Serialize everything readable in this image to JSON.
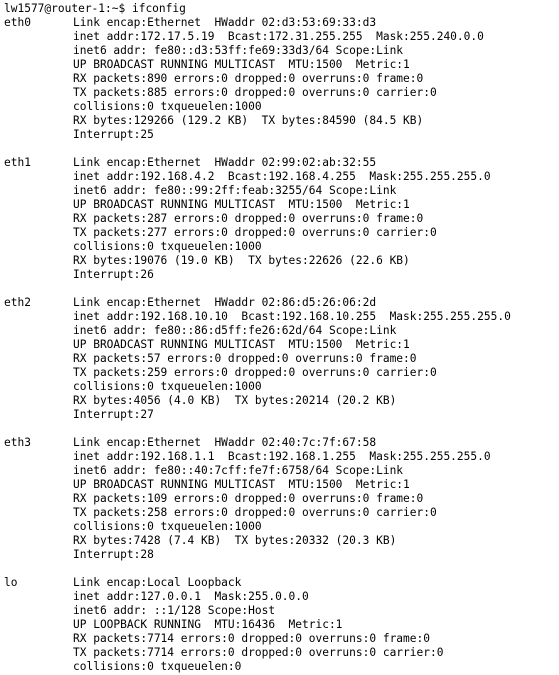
{
  "prompt": {
    "text": "lw1577@router-1:~$ ifconfig"
  },
  "interfaces": [
    {
      "name": "eth0",
      "first_line": "Link encap:Ethernet  HWaddr 02:d3:53:69:33:d3",
      "lines": [
        "inet addr:172.17.5.19  Bcast:172.31.255.255  Mask:255.240.0.0",
        "inet6 addr: fe80::d3:53ff:fe69:33d3/64 Scope:Link",
        "UP BROADCAST RUNNING MULTICAST  MTU:1500  Metric:1",
        "RX packets:890 errors:0 dropped:0 overruns:0 frame:0",
        "TX packets:885 errors:0 dropped:0 overruns:0 carrier:0",
        "collisions:0 txqueuelen:1000",
        "RX bytes:129266 (129.2 KB)  TX bytes:84590 (84.5 KB)",
        "Interrupt:25"
      ]
    },
    {
      "name": "eth1",
      "first_line": "Link encap:Ethernet  HWaddr 02:99:02:ab:32:55",
      "lines": [
        "inet addr:192.168.4.2  Bcast:192.168.4.255  Mask:255.255.255.0",
        "inet6 addr: fe80::99:2ff:feab:3255/64 Scope:Link",
        "UP BROADCAST RUNNING MULTICAST  MTU:1500  Metric:1",
        "RX packets:287 errors:0 dropped:0 overruns:0 frame:0",
        "TX packets:277 errors:0 dropped:0 overruns:0 carrier:0",
        "collisions:0 txqueuelen:1000",
        "RX bytes:19076 (19.0 KB)  TX bytes:22626 (22.6 KB)",
        "Interrupt:26"
      ]
    },
    {
      "name": "eth2",
      "first_line": "Link encap:Ethernet  HWaddr 02:86:d5:26:06:2d",
      "lines": [
        "inet addr:192.168.10.10  Bcast:192.168.10.255  Mask:255.255.255.0",
        "inet6 addr: fe80::86:d5ff:fe26:62d/64 Scope:Link",
        "UP BROADCAST RUNNING MULTICAST  MTU:1500  Metric:1",
        "RX packets:57 errors:0 dropped:0 overruns:0 frame:0",
        "TX packets:259 errors:0 dropped:0 overruns:0 carrier:0",
        "collisions:0 txqueuelen:1000",
        "RX bytes:4056 (4.0 KB)  TX bytes:20214 (20.2 KB)",
        "Interrupt:27"
      ]
    },
    {
      "name": "eth3",
      "first_line": "Link encap:Ethernet  HWaddr 02:40:7c:7f:67:58",
      "lines": [
        "inet addr:192.168.1.1  Bcast:192.168.1.255  Mask:255.255.255.0",
        "inet6 addr: fe80::40:7cff:fe7f:6758/64 Scope:Link",
        "UP BROADCAST RUNNING MULTICAST  MTU:1500  Metric:1",
        "RX packets:109 errors:0 dropped:0 overruns:0 frame:0",
        "TX packets:258 errors:0 dropped:0 overruns:0 carrier:0",
        "collisions:0 txqueuelen:1000",
        "RX bytes:7428 (7.4 KB)  TX bytes:20332 (20.3 KB)",
        "Interrupt:28"
      ]
    },
    {
      "name": "lo",
      "first_line": "Link encap:Local Loopback",
      "lines": [
        "inet addr:127.0.0.1  Mask:255.0.0.0",
        "inet6 addr: ::1/128 Scope:Host",
        "UP LOOPBACK RUNNING  MTU:16436  Metric:1",
        "RX packets:7714 errors:0 dropped:0 overruns:0 frame:0",
        "TX packets:7714 errors:0 dropped:0 overruns:0 carrier:0",
        "collisions:0 txqueuelen:0"
      ]
    }
  ]
}
